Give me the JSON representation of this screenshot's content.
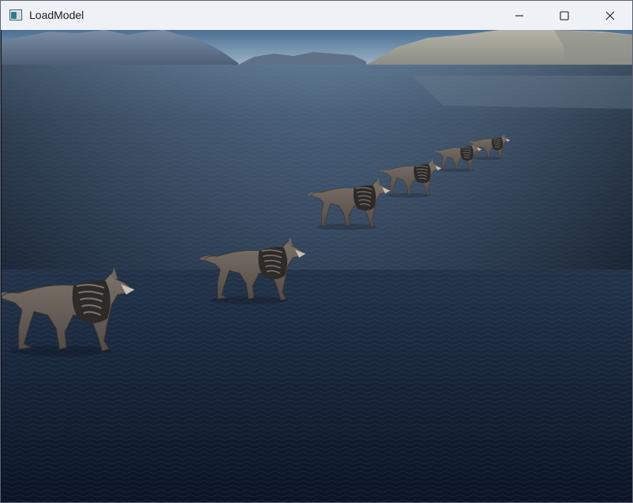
{
  "window": {
    "title": "LoadModel",
    "controls": {
      "minimize": "minimize",
      "maximize": "maximize",
      "close": "close"
    }
  },
  "scene": {
    "background": "skybox",
    "colors": {
      "sky_top": "#4b6f93",
      "sky_bottom": "#9db6c8",
      "water_far": "#4b6079",
      "water_mid": "#293b52",
      "water_near": "#0f1a2b",
      "mountain_left": "#6b7e96",
      "mountain_right": "#9d9e95",
      "wolf_fur": "#6d655f",
      "wolf_dark": "#2e2a28"
    },
    "models": [
      {
        "name": "wolf",
        "count": 6
      }
    ]
  }
}
